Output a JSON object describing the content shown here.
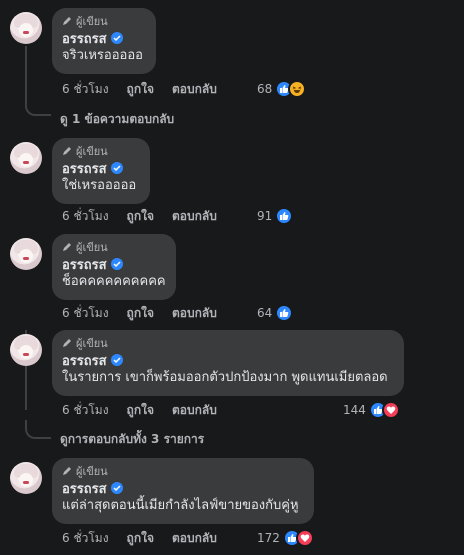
{
  "author_badge": "ผู้เขียน",
  "author_name": "อรรถรส",
  "actions": {
    "time": "6 ชั่วโมง",
    "like": "ถูกใจ",
    "reply": "ตอบกลับ"
  },
  "comments": [
    {
      "text": "จริวเหรอออออ",
      "reaction_count": "68",
      "reactions": [
        "like",
        "haha"
      ]
    },
    {
      "text": "ใช่เหรอออออ",
      "reaction_count": "91",
      "reactions": [
        "like"
      ]
    },
    {
      "text": "ช็อคคคคคคคคคค",
      "reaction_count": "64",
      "reactions": [
        "like"
      ]
    },
    {
      "text": "ในรายการ เขาก็พร้อมออกตัวปกป้องมาก พูดแทนเมียตลอด",
      "reaction_count": "144",
      "reactions": [
        "like",
        "love"
      ]
    },
    {
      "text": "แต่ล่าสุดตอนนี้เมียกำลังไลฟ์ขายของกับคู่หู",
      "reaction_count": "172",
      "reactions": [
        "like",
        "love"
      ]
    }
  ],
  "reply_links": {
    "first": "ดู 1 ข้อความตอบกลับ",
    "second": "ดูการตอบกลับทั้ง 3 รายการ"
  },
  "colors": {
    "like": "#2d88ff",
    "love": "#f33e58",
    "haha": "#f7b125"
  }
}
